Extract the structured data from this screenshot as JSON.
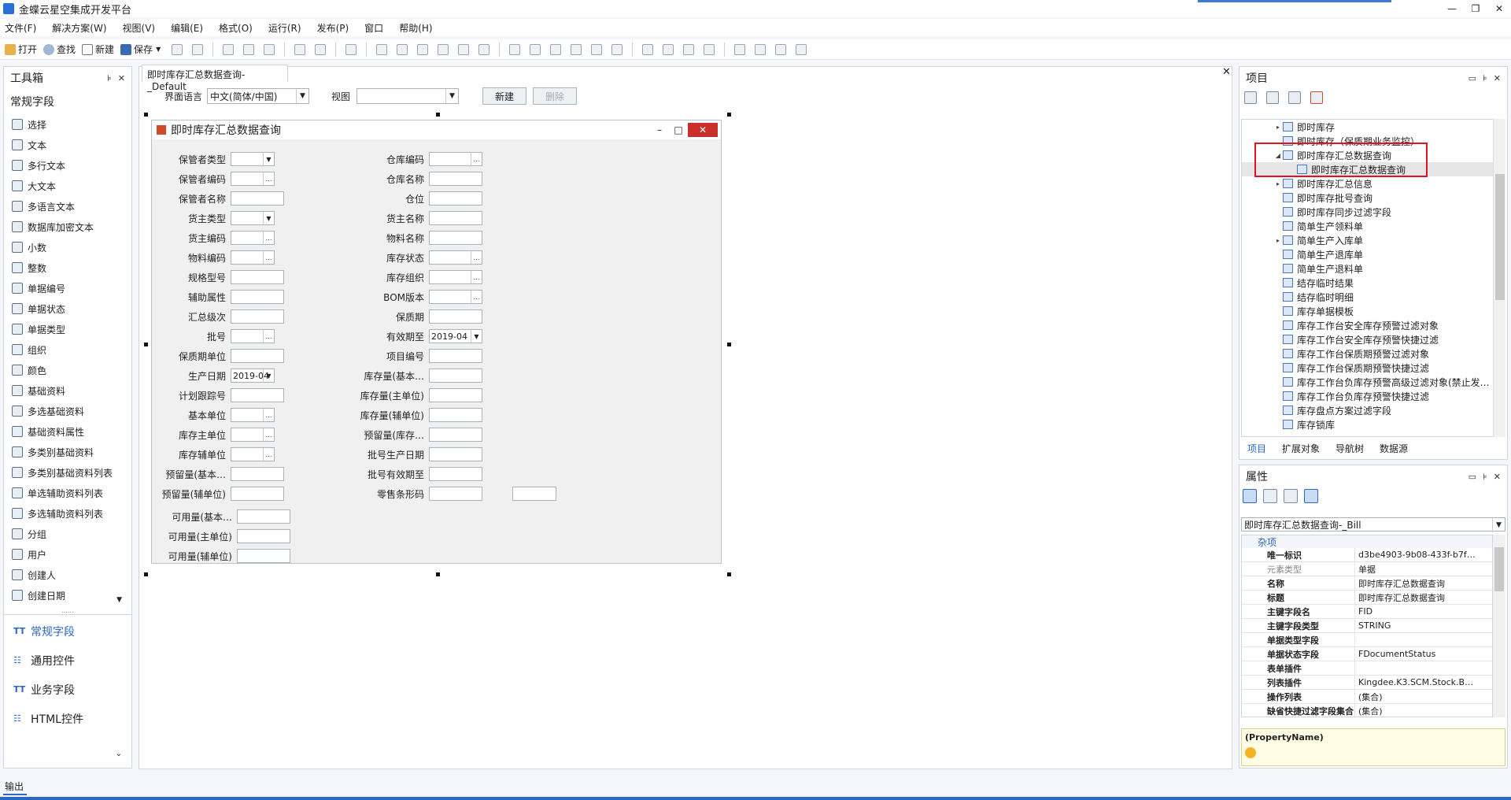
{
  "app": {
    "title": "金蝶云星空集成开发平台"
  },
  "menu": [
    "文件(F)",
    "解决方案(W)",
    "视图(V)",
    "编辑(E)",
    "格式(O)",
    "运行(R)",
    "发布(P)",
    "窗口",
    "帮助(H)"
  ],
  "toolbar": {
    "open": "打开",
    "find": "查找",
    "new": "新建",
    "save": "保存"
  },
  "toolbox": {
    "title": "工具箱",
    "section": "常规字段",
    "items": [
      "选择",
      "文本",
      "多行文本",
      "大文本",
      "多语言文本",
      "数据库加密文本",
      "小数",
      "整数",
      "单据编号",
      "单据状态",
      "单据类型",
      "组织",
      "颜色",
      "基础资料",
      "多选基础资料",
      "基础资料属性",
      "多类别基础资料",
      "多类别基础资料列表",
      "单选辅助资料列表",
      "多选辅助资料列表",
      "分组",
      "用户",
      "创建人",
      "创建日期"
    ],
    "categories": [
      "常规字段",
      "通用控件",
      "业务字段",
      "HTML控件"
    ]
  },
  "designer": {
    "tab": "即时库存汇总数据查询-_Default",
    "lang_label": "界面语言",
    "lang_value": "中文(简体/中国)",
    "view_label": "视图",
    "view_value": "",
    "new_btn": "新建",
    "delete_btn": "删除"
  },
  "form": {
    "title": "即时库存汇总数据查询",
    "left_fields": [
      "保管者类型",
      "保管者编码",
      "保管者名称",
      "货主类型",
      "货主编码",
      "物料编码",
      "规格型号",
      "辅助属性",
      "汇总级次",
      "批号",
      "保质期单位",
      "生产日期",
      "计划跟踪号",
      "基本单位",
      "库存主单位",
      "库存辅单位",
      "预留量(基本…",
      "预留量(辅单位)"
    ],
    "right_fields": [
      "仓库编码",
      "仓库名称",
      "仓位",
      "货主名称",
      "物料名称",
      "库存状态",
      "库存组织",
      "BOM版本",
      "保质期",
      "有效期至",
      "项目编号",
      "库存量(基本…",
      "库存量(主单位)",
      "库存量(辅单位)",
      "预留量(库存…",
      "批号生产日期",
      "批号有效期至",
      "零售条形码"
    ],
    "bottom_fields": [
      "可用量(基本…",
      "可用量(主单位)",
      "可用量(辅单位)"
    ],
    "date_value_1": "2019-04",
    "date_value_2": "2019-04"
  },
  "project": {
    "title": "项目",
    "tree": [
      {
        "label": "即时库存",
        "level": 0,
        "toggle": "▸"
      },
      {
        "label": "即时库存（保质期业务监控）",
        "level": 0,
        "toggle": ""
      },
      {
        "label": "即时库存汇总数据查询",
        "level": 0,
        "toggle": "◢"
      },
      {
        "label": "即时库存汇总数据查询",
        "level": 1,
        "toggle": ""
      },
      {
        "label": "即时库存汇总信息",
        "level": 0,
        "toggle": "▸"
      },
      {
        "label": "即时库存批号查询",
        "level": 0,
        "toggle": ""
      },
      {
        "label": "即时库存同步过滤字段",
        "level": 0,
        "toggle": ""
      },
      {
        "label": "简单生产领料单",
        "level": 0,
        "toggle": ""
      },
      {
        "label": "简单生产入库单",
        "level": 0,
        "toggle": "▸"
      },
      {
        "label": "简单生产退库单",
        "level": 0,
        "toggle": ""
      },
      {
        "label": "简单生产退料单",
        "level": 0,
        "toggle": ""
      },
      {
        "label": "结存临时结果",
        "level": 0,
        "toggle": ""
      },
      {
        "label": "结存临时明细",
        "level": 0,
        "toggle": ""
      },
      {
        "label": "库存单据模板",
        "level": 0,
        "toggle": ""
      },
      {
        "label": "库存工作台安全库存预警过滤对象",
        "level": 0,
        "toggle": ""
      },
      {
        "label": "库存工作台安全库存预警快捷过滤",
        "level": 0,
        "toggle": ""
      },
      {
        "label": "库存工作台保质期预警过滤对象",
        "level": 0,
        "toggle": ""
      },
      {
        "label": "库存工作台保质期预警快捷过滤",
        "level": 0,
        "toggle": ""
      },
      {
        "label": "库存工作台负库存预警高级过滤对象(禁止发…",
        "level": 0,
        "toggle": ""
      },
      {
        "label": "库存工作台负库存预警快捷过滤",
        "level": 0,
        "toggle": ""
      },
      {
        "label": "库存盘点方案过滤字段",
        "level": 0,
        "toggle": ""
      },
      {
        "label": "库存锁库",
        "level": 0,
        "toggle": ""
      }
    ],
    "tabs": [
      "项目",
      "扩展对象",
      "导航树",
      "数据源"
    ]
  },
  "properties": {
    "title": "属性",
    "object": "即时库存汇总数据查询-_Bill",
    "group": "杂项",
    "rows": [
      {
        "name": "唯一标识",
        "value": "d3be4903-9b08-433f-b7f…",
        "dim": false
      },
      {
        "name": "元素类型",
        "value": "单据",
        "dim": true
      },
      {
        "name": "名称",
        "value": "即时库存汇总数据查询",
        "dim": false
      },
      {
        "name": "标题",
        "value": "即时库存汇总数据查询",
        "dim": false
      },
      {
        "name": "主键字段名",
        "value": "FID",
        "dim": false
      },
      {
        "name": "主键字段类型",
        "value": "STRING",
        "dim": false
      },
      {
        "name": "单据类型字段",
        "value": "",
        "dim": false
      },
      {
        "name": "单据状态字段",
        "value": "FDocumentStatus",
        "dim": false
      },
      {
        "name": "表单插件",
        "value": "",
        "dim": false
      },
      {
        "name": "列表插件",
        "value": "Kingdee.K3.SCM.Stock.B…",
        "dim": false
      },
      {
        "name": "操作列表",
        "value": "(集合)",
        "dim": false
      },
      {
        "name": "缺省快捷过滤字段集合",
        "value": "(集合)",
        "dim": false
      }
    ],
    "help_title": "(PropertyName)"
  },
  "output": {
    "label": "输出"
  },
  "colors": {
    "accent": "#2d66c4",
    "highlight": "#e0141e"
  }
}
